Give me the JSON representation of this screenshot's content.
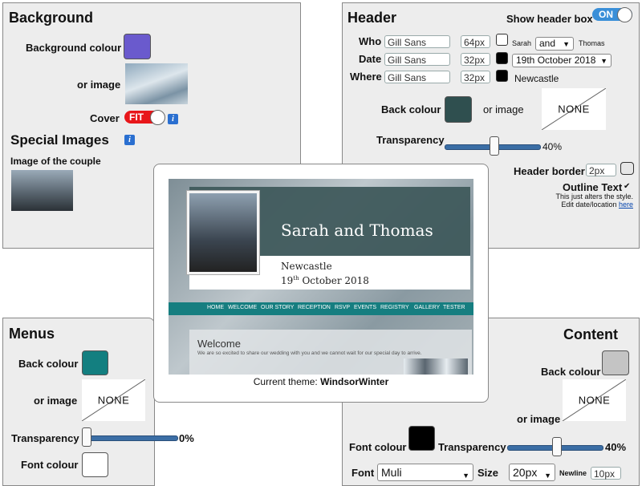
{
  "background": {
    "title": "Background",
    "colour_label": "Background colour",
    "colour_value": "#6a5acd",
    "image_label": "or image",
    "cover_label": "Cover",
    "cover_toggle": "FIT"
  },
  "special_images": {
    "title": "Special Images",
    "couple_label": "Image of the couple"
  },
  "header": {
    "title": "Header",
    "show_box_label": "Show header box",
    "show_box_toggle": "ON",
    "who_label": "Who",
    "who_font": "Gill Sans",
    "who_size": "64px",
    "who_name1": "Sarah",
    "who_joiner": "and",
    "who_name2": "Thomas",
    "date_label": "Date",
    "date_font": "Gill Sans",
    "date_size": "32px",
    "date_value": "19th October 2018",
    "where_label": "Where",
    "where_font": "Gill Sans",
    "where_size": "32px",
    "where_value": "Newcastle",
    "back_colour_label": "Back colour",
    "back_colour_value": "#2f4f4f",
    "or_image_label": "or image",
    "none_label": "NONE",
    "transparency_label": "Transparency",
    "transparency_value": "40%",
    "transparency_fraction": 0.4,
    "border_label": "Header border",
    "border_value": "2px",
    "outline_label": "Outline Text",
    "outline_check": "✔",
    "note_line1": "This just alters the style.",
    "note_line2": "Edit date/location",
    "note_link": "here"
  },
  "preview": {
    "couple": "Sarah and Thomas",
    "location": "Newcastle",
    "date_day": "19",
    "date_sup": "th",
    "date_rest": "October 2018",
    "menu": [
      "HOME",
      "WELCOME",
      "OUR STORY",
      "RECEPTION",
      "RSVP",
      "EVENTS",
      "REGISTRY",
      "GALLERY",
      "TESTER"
    ],
    "welcome_title": "Welcome",
    "welcome_text": "We are so excited to share our wedding with you and we cannot wait for our special day to arrive.",
    "caption_prefix": "Current theme:",
    "caption_theme": "WindsorWinter"
  },
  "menus": {
    "title": "Menus",
    "back_colour_label": "Back colour",
    "back_colour_value": "#137f80",
    "or_image_label": "or image",
    "none_label": "NONE",
    "transparency_label": "Transparency",
    "transparency_value": "0%",
    "transparency_fraction": 0,
    "font_colour_label": "Font colour",
    "font_colour_value": "#ffffff"
  },
  "content": {
    "title": "Content",
    "back_colour_label": "Back colour",
    "back_colour_value": "#c4c4c4",
    "or_image_label": "or image",
    "none_label": "NONE",
    "font_colour_label": "Font colour",
    "font_colour_value": "#000000",
    "transparency_label": "Transparency",
    "transparency_value": "40%",
    "transparency_fraction": 0.4,
    "font_label": "Font",
    "font_value": "Muli",
    "size_label": "Size",
    "size_value": "20px",
    "newline_label": "Newline",
    "newline_value": "10px"
  }
}
